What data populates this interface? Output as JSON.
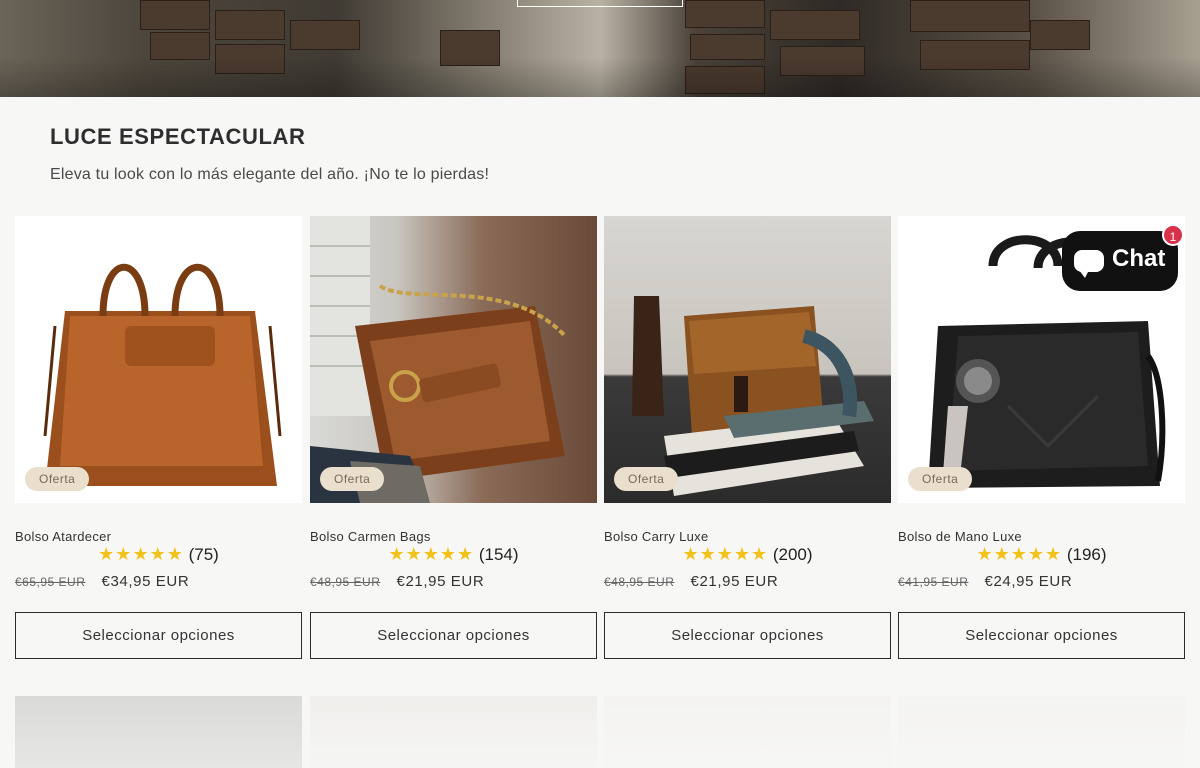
{
  "hero": {
    "button_label": ""
  },
  "section": {
    "title": "LUCE ESPECTACULAR",
    "subtitle": "Eleva tu look con lo más elegante del año. ¡No te lo pierdas!"
  },
  "products": [
    {
      "badge": "Oferta",
      "name": "Bolso Atardecer",
      "stars": "★★★★★",
      "reviews": "(75)",
      "old_price": "€65,95 EUR",
      "price": "€34,95 EUR",
      "button": "Seleccionar opciones"
    },
    {
      "badge": "Oferta",
      "name": "Bolso Carmen Bags",
      "stars": "★★★★★",
      "reviews": "(154)",
      "old_price": "€48,95 EUR",
      "price": "€21,95 EUR",
      "button": "Seleccionar opciones"
    },
    {
      "badge": "Oferta",
      "name": "Bolso Carry Luxe",
      "stars": "★★★★★",
      "reviews": "(200)",
      "old_price": "€48,95 EUR",
      "price": "€21,95 EUR",
      "button": "Seleccionar opciones"
    },
    {
      "badge": "Oferta",
      "name": "Bolso de Mano Luxe",
      "stars": "★★★★★",
      "reviews": "(196)",
      "old_price": "€41,95 EUR",
      "price": "€24,95 EUR",
      "button": "Seleccionar opciones"
    }
  ],
  "chat": {
    "label": "Chat",
    "unread": "1"
  },
  "colors": {
    "star": "#f2c21a",
    "badge_bg": "#eadfcd",
    "chat_bg": "#111111",
    "notify": "#d8324a"
  }
}
